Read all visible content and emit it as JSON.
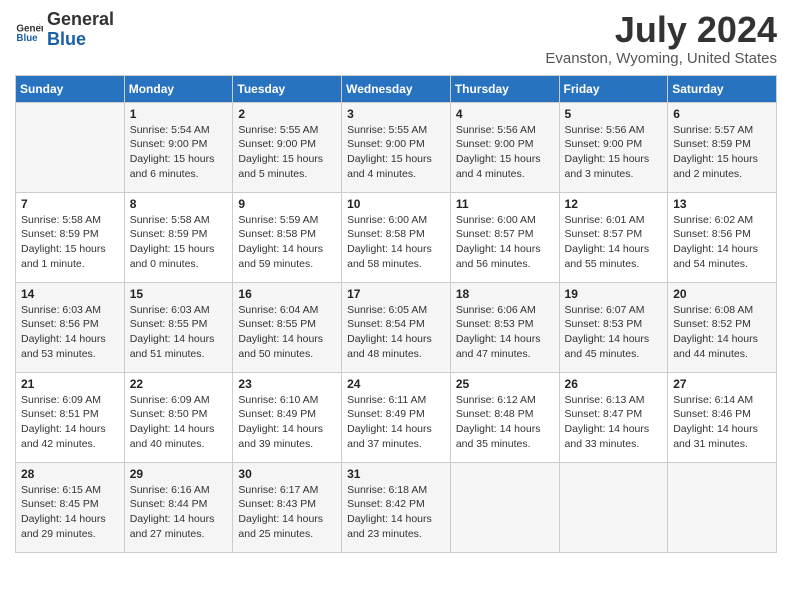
{
  "header": {
    "logo_general": "General",
    "logo_blue": "Blue",
    "month_title": "July 2024",
    "location": "Evanston, Wyoming, United States"
  },
  "days_of_week": [
    "Sunday",
    "Monday",
    "Tuesday",
    "Wednesday",
    "Thursday",
    "Friday",
    "Saturday"
  ],
  "weeks": [
    [
      {
        "day": "",
        "info": ""
      },
      {
        "day": "1",
        "info": "Sunrise: 5:54 AM\nSunset: 9:00 PM\nDaylight: 15 hours\nand 6 minutes."
      },
      {
        "day": "2",
        "info": "Sunrise: 5:55 AM\nSunset: 9:00 PM\nDaylight: 15 hours\nand 5 minutes."
      },
      {
        "day": "3",
        "info": "Sunrise: 5:55 AM\nSunset: 9:00 PM\nDaylight: 15 hours\nand 4 minutes."
      },
      {
        "day": "4",
        "info": "Sunrise: 5:56 AM\nSunset: 9:00 PM\nDaylight: 15 hours\nand 4 minutes."
      },
      {
        "day": "5",
        "info": "Sunrise: 5:56 AM\nSunset: 9:00 PM\nDaylight: 15 hours\nand 3 minutes."
      },
      {
        "day": "6",
        "info": "Sunrise: 5:57 AM\nSunset: 8:59 PM\nDaylight: 15 hours\nand 2 minutes."
      }
    ],
    [
      {
        "day": "7",
        "info": "Sunrise: 5:58 AM\nSunset: 8:59 PM\nDaylight: 15 hours\nand 1 minute."
      },
      {
        "day": "8",
        "info": "Sunrise: 5:58 AM\nSunset: 8:59 PM\nDaylight: 15 hours\nand 0 minutes."
      },
      {
        "day": "9",
        "info": "Sunrise: 5:59 AM\nSunset: 8:58 PM\nDaylight: 14 hours\nand 59 minutes."
      },
      {
        "day": "10",
        "info": "Sunrise: 6:00 AM\nSunset: 8:58 PM\nDaylight: 14 hours\nand 58 minutes."
      },
      {
        "day": "11",
        "info": "Sunrise: 6:00 AM\nSunset: 8:57 PM\nDaylight: 14 hours\nand 56 minutes."
      },
      {
        "day": "12",
        "info": "Sunrise: 6:01 AM\nSunset: 8:57 PM\nDaylight: 14 hours\nand 55 minutes."
      },
      {
        "day": "13",
        "info": "Sunrise: 6:02 AM\nSunset: 8:56 PM\nDaylight: 14 hours\nand 54 minutes."
      }
    ],
    [
      {
        "day": "14",
        "info": "Sunrise: 6:03 AM\nSunset: 8:56 PM\nDaylight: 14 hours\nand 53 minutes."
      },
      {
        "day": "15",
        "info": "Sunrise: 6:03 AM\nSunset: 8:55 PM\nDaylight: 14 hours\nand 51 minutes."
      },
      {
        "day": "16",
        "info": "Sunrise: 6:04 AM\nSunset: 8:55 PM\nDaylight: 14 hours\nand 50 minutes."
      },
      {
        "day": "17",
        "info": "Sunrise: 6:05 AM\nSunset: 8:54 PM\nDaylight: 14 hours\nand 48 minutes."
      },
      {
        "day": "18",
        "info": "Sunrise: 6:06 AM\nSunset: 8:53 PM\nDaylight: 14 hours\nand 47 minutes."
      },
      {
        "day": "19",
        "info": "Sunrise: 6:07 AM\nSunset: 8:53 PM\nDaylight: 14 hours\nand 45 minutes."
      },
      {
        "day": "20",
        "info": "Sunrise: 6:08 AM\nSunset: 8:52 PM\nDaylight: 14 hours\nand 44 minutes."
      }
    ],
    [
      {
        "day": "21",
        "info": "Sunrise: 6:09 AM\nSunset: 8:51 PM\nDaylight: 14 hours\nand 42 minutes."
      },
      {
        "day": "22",
        "info": "Sunrise: 6:09 AM\nSunset: 8:50 PM\nDaylight: 14 hours\nand 40 minutes."
      },
      {
        "day": "23",
        "info": "Sunrise: 6:10 AM\nSunset: 8:49 PM\nDaylight: 14 hours\nand 39 minutes."
      },
      {
        "day": "24",
        "info": "Sunrise: 6:11 AM\nSunset: 8:49 PM\nDaylight: 14 hours\nand 37 minutes."
      },
      {
        "day": "25",
        "info": "Sunrise: 6:12 AM\nSunset: 8:48 PM\nDaylight: 14 hours\nand 35 minutes."
      },
      {
        "day": "26",
        "info": "Sunrise: 6:13 AM\nSunset: 8:47 PM\nDaylight: 14 hours\nand 33 minutes."
      },
      {
        "day": "27",
        "info": "Sunrise: 6:14 AM\nSunset: 8:46 PM\nDaylight: 14 hours\nand 31 minutes."
      }
    ],
    [
      {
        "day": "28",
        "info": "Sunrise: 6:15 AM\nSunset: 8:45 PM\nDaylight: 14 hours\nand 29 minutes."
      },
      {
        "day": "29",
        "info": "Sunrise: 6:16 AM\nSunset: 8:44 PM\nDaylight: 14 hours\nand 27 minutes."
      },
      {
        "day": "30",
        "info": "Sunrise: 6:17 AM\nSunset: 8:43 PM\nDaylight: 14 hours\nand 25 minutes."
      },
      {
        "day": "31",
        "info": "Sunrise: 6:18 AM\nSunset: 8:42 PM\nDaylight: 14 hours\nand 23 minutes."
      },
      {
        "day": "",
        "info": ""
      },
      {
        "day": "",
        "info": ""
      },
      {
        "day": "",
        "info": ""
      }
    ]
  ]
}
